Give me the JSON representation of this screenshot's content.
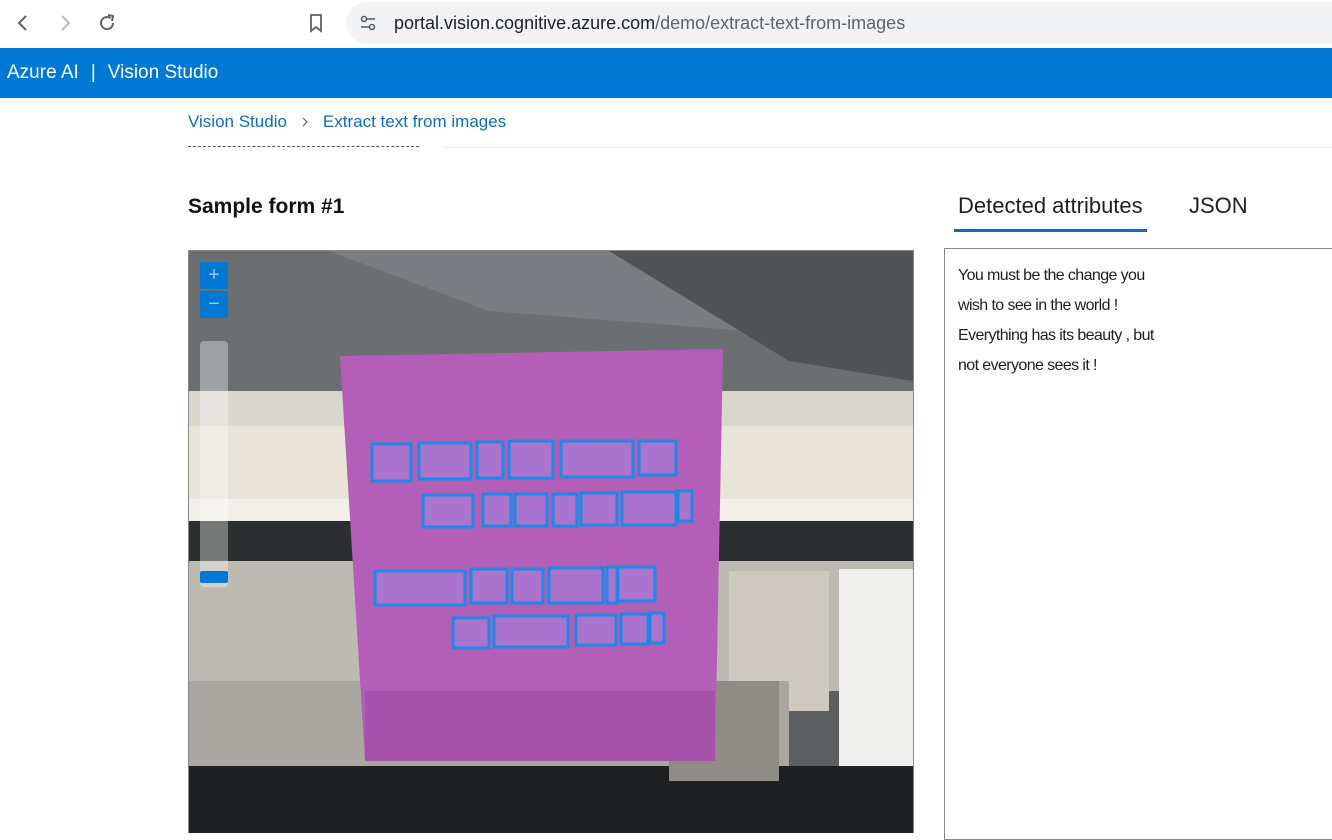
{
  "browser": {
    "url_host": "portal.vision.cognitive.azure.com",
    "url_path": "/demo/extract-text-from-images"
  },
  "app": {
    "brand": "Azure AI",
    "separator": "|",
    "product": "Vision Studio"
  },
  "breadcrumb": {
    "root": "Vision Studio",
    "current": "Extract text from images"
  },
  "sample": {
    "title": "Sample form #1"
  },
  "zoom": {
    "in_label": "+",
    "out_label": "−",
    "level": 0.1
  },
  "tabs": [
    {
      "label": "Detected attributes",
      "active": true
    },
    {
      "label": "JSON",
      "active": false
    }
  ],
  "detected_lines": [
    "You must be the change you",
    "wish to see in the world !",
    "Everything has its beauty , but",
    "not everyone sees it !"
  ],
  "colors": {
    "accent": "#0078d4",
    "link": "#0f6cbd",
    "note": "#b35fb8",
    "box": "#1e88e5"
  }
}
